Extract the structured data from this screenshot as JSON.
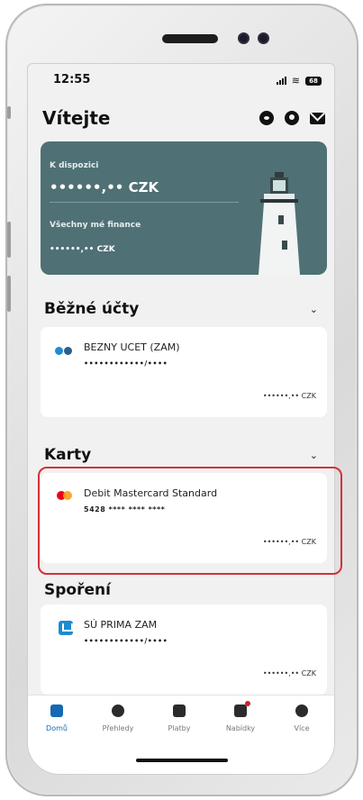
{
  "status_bar": {
    "time": "12:55",
    "battery": "68"
  },
  "header": {
    "title": "Vítejte"
  },
  "hero": {
    "available_label": "K dispozici",
    "available_value": "••••••,•• CZK",
    "finances_label": "Všechny mé finance",
    "finances_value": "••••••,•• CZK"
  },
  "sections": {
    "accounts": {
      "title": "Běžné účty",
      "item": {
        "name": "BEZNY UCET (ZAM)",
        "number": "••••••••••••/••••",
        "balance": "••••••,•• CZK"
      }
    },
    "cards": {
      "title": "Karty",
      "item": {
        "name": "Debit Mastercard Standard",
        "number": "5428 **** **** ****",
        "balance": "••••••,•• CZK"
      }
    },
    "savings": {
      "title": "Spoření",
      "item": {
        "name": "SÚ PRIMA ZAM",
        "number": "••••••••••••/••••",
        "balance": "••••••,•• CZK"
      }
    }
  },
  "tabbar": {
    "tabs": [
      {
        "label": "Domů",
        "icon": "home-icon",
        "active": true
      },
      {
        "label": "Přehledy",
        "icon": "pie-chart-icon",
        "active": false
      },
      {
        "label": "Platby",
        "icon": "payment-icon",
        "active": false
      },
      {
        "label": "Nabídky",
        "icon": "offers-icon",
        "active": false
      },
      {
        "label": "Více",
        "icon": "info-icon",
        "active": false
      }
    ]
  },
  "colors": {
    "accent_blue": "#1468b4",
    "hero_bg": "#4f7075",
    "highlight_red": "#d6303a",
    "mastercard_red": "#eb001b",
    "mastercard_orange": "#f79e1b"
  }
}
